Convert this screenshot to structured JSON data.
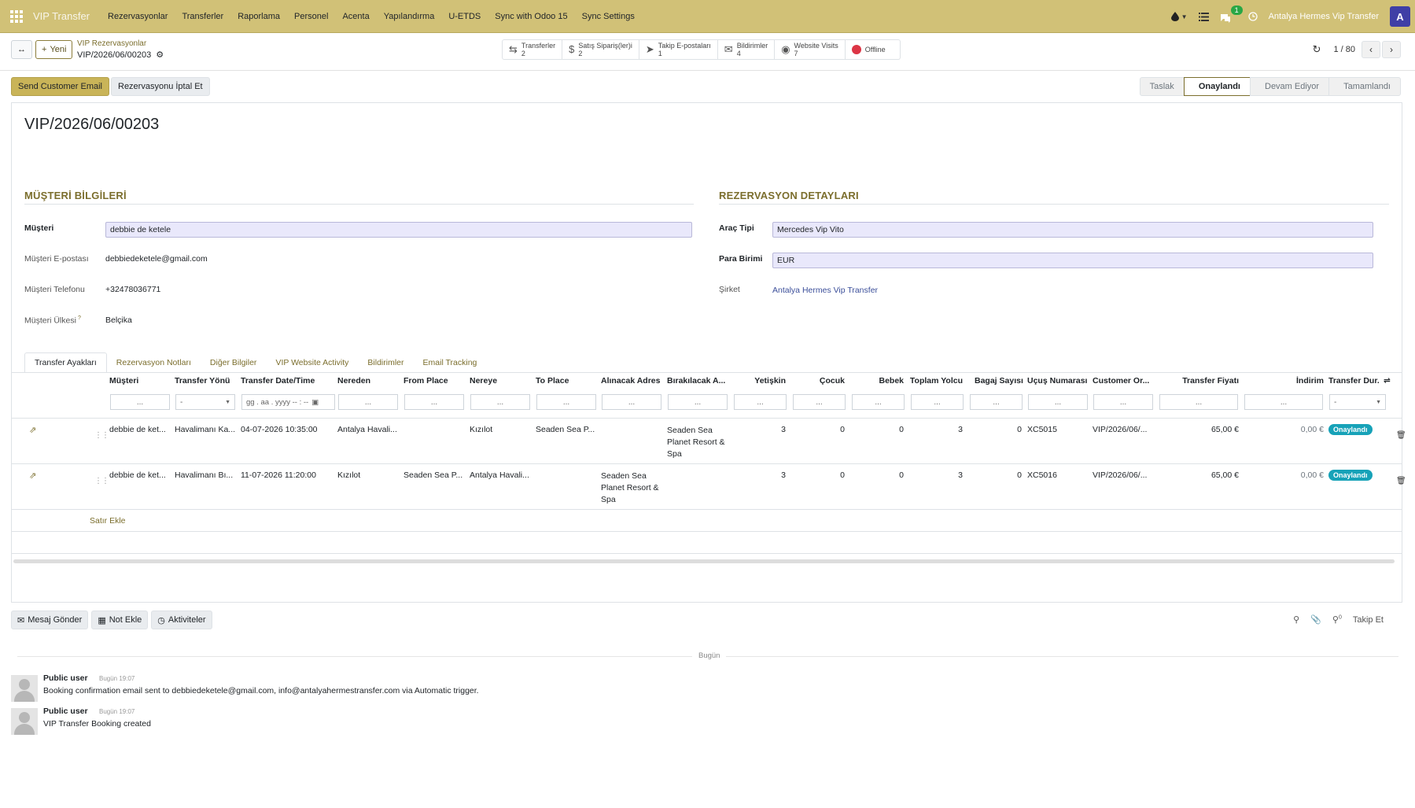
{
  "topbar": {
    "brand": "VIP Transfer",
    "menu": [
      "Rezervasyonlar",
      "Transferler",
      "Raporlama",
      "Personel",
      "Acenta",
      "Yapılandırma",
      "U-ETDS",
      "Sync with Odoo 15",
      "Sync Settings"
    ],
    "chat_count": "1",
    "company": "Antalya Hermes Vip Transfer",
    "avatar_letter": "A",
    "accent_color": "#d1c177"
  },
  "control": {
    "new_label": "Yeni",
    "breadcrumb_parent": "VIP Rezervasyonlar",
    "breadcrumb_current": "VIP/2026/06/00203",
    "smart_buttons": [
      {
        "label": "Transferler",
        "count": "2",
        "icon": "arrows-icon"
      },
      {
        "label": "Satış Sipariş(ler)i",
        "count": "2",
        "icon": "dollar-icon"
      },
      {
        "label": "Takip E-postaları",
        "count": "1",
        "icon": "paper-plane-icon"
      },
      {
        "label": "Bildirimler",
        "count": "4",
        "icon": "envelope-icon"
      },
      {
        "label": "Website Visits",
        "count": "7",
        "icon": "globe-icon"
      },
      {
        "label": "Offline",
        "count": "",
        "icon": "status-dot-icon"
      }
    ],
    "pager": "1 / 80"
  },
  "actions": {
    "send_email": "Send Customer Email",
    "cancel_booking": "Rezervasyonu İptal Et"
  },
  "stages": [
    "Taslak",
    "Onaylandı",
    "Devam Ediyor",
    "Tamamlandı"
  ],
  "active_stage": "Onaylandı",
  "record": {
    "title": "VIP/2026/06/00203",
    "customer_section": "MÜŞTERİ BİLGİLERİ",
    "booking_section": "REZERVASYON DETAYLARI",
    "customer_label": "Müşteri",
    "customer_value": "debbie de ketele",
    "email_label": "Müşteri E-postası",
    "email_value": "debbiedeketele@gmail.com",
    "phone_label": "Müşteri Telefonu",
    "phone_value": "+32478036771",
    "country_label": "Müşteri Ülkesi",
    "country_help": "?",
    "country_value": "Belçika",
    "vehicle_label": "Araç Tipi",
    "vehicle_value": "Mercedes Vip Vito",
    "currency_label": "Para Birimi",
    "currency_value": "EUR",
    "company_label": "Şirket",
    "company_value": "Antalya Hermes Vip Transfer"
  },
  "tabs": [
    "Transfer Ayakları",
    "Rezervasyon Notları",
    "Diğer Bilgiler",
    "VIP Website Activity",
    "Bildirimler",
    "Email Tracking"
  ],
  "table": {
    "columns": [
      "Müşteri",
      "Transfer Yönü",
      "Transfer Date/Time",
      "Nereden",
      "From Place",
      "Nereye",
      "To Place",
      "Alınacak Adres",
      "Bırakılacak A...",
      "Yetişkin",
      "Çocuk",
      "Bebek",
      "Toplam Yolcu",
      "Bagaj Sayısı",
      "Uçuş Numarası",
      "Customer Or...",
      "Transfer Fiyatı",
      "İndirim",
      "Transfer Dur..."
    ],
    "filter_placeholder": "...",
    "filter_select": "-",
    "filter_date": "gg . aa . yyyy   -- : --",
    "rows": [
      {
        "customer": "debbie de ket...",
        "direction": "Havalimanı Ka...",
        "datetime": "04-07-2026 10:35:00",
        "from": "Antalya Havali...",
        "from_place": "",
        "to": "Kızılot",
        "to_place": "Seaden Sea P...",
        "pickup": "",
        "dropoff": "Seaden Sea Planet Resort & Spa",
        "adult": "3",
        "child": "0",
        "baby": "0",
        "total": "3",
        "luggage": "0",
        "flight": "XC5015",
        "order": "VIP/2026/06/...",
        "price": "65,00 €",
        "discount": "0,00 €",
        "status": "Onaylandı"
      },
      {
        "customer": "debbie de ket...",
        "direction": "Havalimanı Bı...",
        "datetime": "11-07-2026 11:20:00",
        "from": "Kızılot",
        "from_place": "Seaden Sea P...",
        "to": "Antalya Havali...",
        "to_place": "",
        "pickup": "Seaden Sea Planet Resort & Spa",
        "dropoff": "",
        "adult": "3",
        "child": "0",
        "baby": "0",
        "total": "3",
        "luggage": "0",
        "flight": "XC5016",
        "order": "VIP/2026/06/...",
        "price": "65,00 €",
        "discount": "0,00 €",
        "status": "Onaylandı"
      }
    ],
    "add_line": "Satır Ekle"
  },
  "chatter": {
    "send_message": "Mesaj Gönder",
    "log_note": "Not Ekle",
    "activities": "Aktiviteler",
    "followers_count": "0",
    "follow": "Takip Et",
    "today": "Bugün",
    "messages": [
      {
        "author": "Public user",
        "time": "Bugün 19:07",
        "body": "Booking confirmation email sent to debbiedeketele@gmail.com, info@antalyahermestransfer.com via Automatic trigger."
      },
      {
        "author": "Public user",
        "time": "Bugün 19:07",
        "body": "VIP Transfer Booking created"
      }
    ]
  }
}
